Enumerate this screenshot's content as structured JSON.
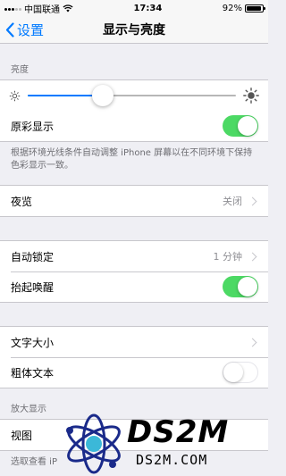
{
  "statusbar": {
    "carrier": "中国联通",
    "time": "17:34",
    "battery": "92%",
    "battery_level": 0.92
  },
  "nav": {
    "back_label": "设置",
    "title": "显示与亮度"
  },
  "brightness": {
    "section_header": "亮度",
    "level": 0.36
  },
  "true_tone": {
    "label": "原彩显示",
    "on": true,
    "footer": "根据环境光线条件自动调整 iPhone 屏幕以在不同环境下保持色彩显示一致。"
  },
  "night_shift": {
    "label": "夜览",
    "value": "关闭"
  },
  "auto_lock": {
    "label": "自动锁定",
    "value": "1 分钟"
  },
  "raise_to_wake": {
    "label": "抬起唤醒",
    "on": true
  },
  "text_size": {
    "label": "文字大小"
  },
  "bold_text": {
    "label": "粗体文本",
    "on": false
  },
  "zoom": {
    "section_header": "放大显示",
    "view_label": "视图",
    "footer": "选取查看 iP"
  },
  "watermark": {
    "title": "DS2M",
    "subtitle": "DS2M.COM"
  },
  "colors": {
    "accent": "#007aff",
    "toggle_on": "#4cd964"
  },
  "icons": [
    "chevron-left-icon",
    "wifi-icon",
    "sun-small-icon",
    "sun-large-icon",
    "chevron-right-icon"
  ]
}
